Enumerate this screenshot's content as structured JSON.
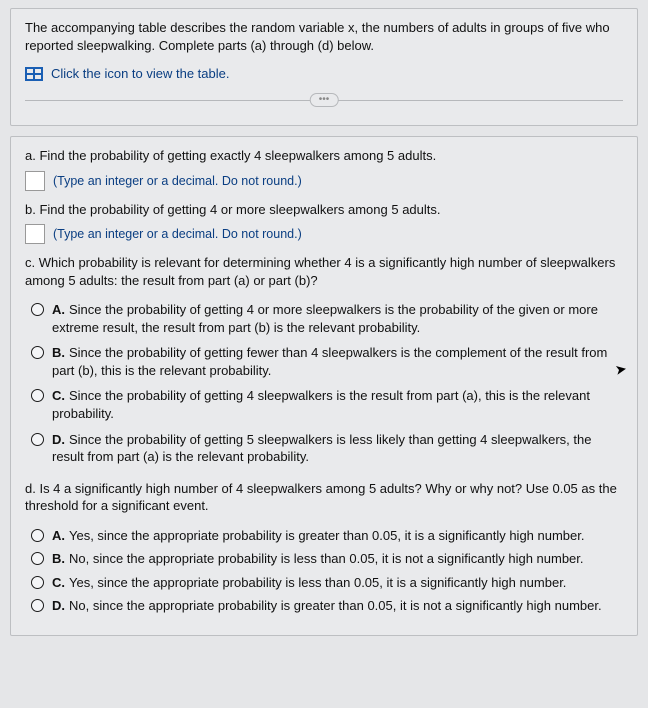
{
  "intro": "The accompanying table describes the random variable x, the numbers of adults in groups of five who reported sleepwalking. Complete parts (a) through (d) below.",
  "table_link": "Click the icon to view the table.",
  "ellipsis": "•••",
  "partA": {
    "prompt": "a. Find the probability of getting exactly 4 sleepwalkers among 5 adults.",
    "hint": "(Type an integer or a decimal. Do not round.)"
  },
  "partB": {
    "prompt": "b. Find the probability of getting 4 or more sleepwalkers among 5 adults.",
    "hint": "(Type an integer or a decimal. Do not round.)"
  },
  "partC": {
    "prompt": "c. Which probability is relevant for determining whether 4 is a significantly high number of sleepwalkers among 5 adults: the result from part (a) or part (b)?",
    "options": {
      "A": "Since the probability of getting 4 or more sleepwalkers is the probability of the given or more extreme result, the result from part (b) is the relevant probability.",
      "B": "Since the probability of getting fewer than 4 sleepwalkers is the complement of the result from part (b), this is the relevant probability.",
      "C": "Since the probability of getting 4 sleepwalkers is the result from part (a), this is the relevant probability.",
      "D": "Since the probability of getting 5 sleepwalkers is less likely than getting 4 sleepwalkers, the result from part (a) is the relevant probability."
    }
  },
  "partD": {
    "prompt": "d. Is 4 a significantly high number of 4 sleepwalkers among 5 adults? Why or why not? Use 0.05 as the threshold for a significant event.",
    "options": {
      "A": "Yes, since the appropriate probability is greater than 0.05, it is a significantly high number.",
      "B": "No, since the appropriate probability is less than 0.05, it is not a significantly high number.",
      "C": "Yes, since the appropriate probability is less than 0.05, it is a significantly high number.",
      "D": "No, since the appropriate probability is greater than 0.05, it is not a significantly high number."
    }
  },
  "labels": {
    "A": "A.",
    "B": "B.",
    "C": "C.",
    "D": "D."
  }
}
